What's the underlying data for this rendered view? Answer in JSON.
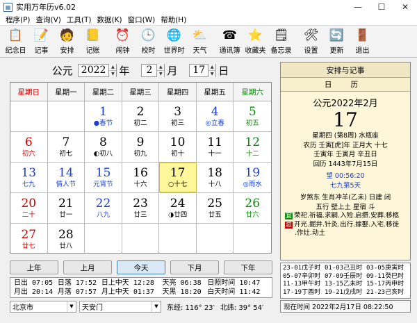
{
  "window": {
    "title": "实用万年历v6.02",
    "controls": [
      "—",
      "☐",
      "✕"
    ]
  },
  "menu": [
    "程序(P)",
    "查询(V)",
    "工具(T)",
    "数据(K)",
    "窗口(W)",
    "帮助(H)"
  ],
  "toolbar": [
    {
      "label": "纪念日",
      "icon": "memorial-icon",
      "glyph": "📋"
    },
    {
      "label": "记事",
      "icon": "note-icon",
      "glyph": "📝"
    },
    {
      "label": "安排",
      "icon": "schedule-icon",
      "glyph": "🧑"
    },
    {
      "label": "记账",
      "icon": "ledger-icon",
      "glyph": "📒"
    },
    {
      "label": "闹钟",
      "icon": "alarm-icon",
      "glyph": "⏰"
    },
    {
      "label": "校时",
      "icon": "time-sync-icon",
      "glyph": "🕒"
    },
    {
      "label": "世界时",
      "icon": "globe-icon",
      "glyph": "🌐"
    },
    {
      "label": "天气",
      "icon": "weather-icon",
      "glyph": "⛅"
    },
    {
      "label": "通讯簿",
      "icon": "address-book-icon",
      "glyph": "☎"
    },
    {
      "label": "收藏夹",
      "icon": "favorites-icon",
      "glyph": "⭐"
    },
    {
      "label": "备忘录",
      "icon": "memo-icon",
      "glyph": "🗒"
    },
    {
      "label": "设置",
      "icon": "settings-icon",
      "glyph": "🛠"
    },
    {
      "label": "更新",
      "icon": "update-icon",
      "glyph": "🔄"
    },
    {
      "label": "退出",
      "icon": "exit-icon",
      "glyph": "🚪"
    }
  ],
  "yearbar": {
    "prefix": "公元",
    "year": "2022",
    "year_unit": "年",
    "month": "2",
    "month_unit": "月",
    "day": "17",
    "day_unit": "日"
  },
  "weekdays": [
    {
      "label": "星期日",
      "color": "#d00000"
    },
    {
      "label": "星期一",
      "color": "#000000"
    },
    {
      "label": "星期二",
      "color": "#000000"
    },
    {
      "label": "星期三",
      "color": "#000000"
    },
    {
      "label": "星期四",
      "color": "#000000"
    },
    {
      "label": "星期五",
      "color": "#000000"
    },
    {
      "label": "星期六",
      "color": "#0a8a0a"
    }
  ],
  "weeks": [
    [
      null,
      null,
      {
        "d": "1",
        "sub": "●春节",
        "c": "#1a3fd0",
        "sc": "#1a3fd0"
      },
      {
        "d": "2",
        "sub": "初二",
        "c": "#000",
        "sc": "#000"
      },
      {
        "d": "3",
        "sub": "初三",
        "c": "#000",
        "sc": "#000"
      },
      {
        "d": "4",
        "sub": "◎立春",
        "c": "#1a3fd0",
        "sc": "#1a3fd0"
      },
      {
        "d": "5",
        "sub": "初五",
        "c": "#0a8a0a",
        "sc": "#0a8a0a"
      }
    ],
    [
      {
        "d": "6",
        "sub": "初六",
        "c": "#d00000",
        "sc": "#d00000"
      },
      {
        "d": "7",
        "sub": "初七",
        "c": "#000",
        "sc": "#000"
      },
      {
        "d": "8",
        "sub": "◐初八",
        "c": "#000",
        "sc": "#000"
      },
      {
        "d": "9",
        "sub": "初九",
        "c": "#000",
        "sc": "#000"
      },
      {
        "d": "10",
        "sub": "初十",
        "c": "#000",
        "sc": "#000"
      },
      {
        "d": "11",
        "sub": "十一",
        "c": "#000",
        "sc": "#000"
      },
      {
        "d": "12",
        "sub": "十二",
        "c": "#0a8a0a",
        "sc": "#0a8a0a"
      }
    ],
    [
      {
        "d": "13",
        "sub": "七九",
        "c": "#1a3fd0",
        "sc": "#1a3fd0"
      },
      {
        "d": "14",
        "sub": "情人节",
        "c": "#1a3fd0",
        "sc": "#1a3fd0"
      },
      {
        "d": "15",
        "sub": "元宵节",
        "c": "#1a3fd0",
        "sc": "#1a3fd0"
      },
      {
        "d": "16",
        "sub": "十六",
        "c": "#000",
        "sc": "#000"
      },
      {
        "d": "17",
        "sub": "○十七",
        "c": "#000",
        "sc": "#000",
        "today": true
      },
      {
        "d": "18",
        "sub": "十八",
        "c": "#000",
        "sc": "#000"
      },
      {
        "d": "19",
        "sub": "◎雨水",
        "c": "#1a3fd0",
        "sc": "#1a3fd0"
      }
    ],
    [
      {
        "d": "20",
        "sub": "二十",
        "c": "#d00000",
        "sc": "#d00000"
      },
      {
        "d": "21",
        "sub": "廿一",
        "c": "#000",
        "sc": "#000"
      },
      {
        "d": "22",
        "sub": "八九",
        "c": "#1a3fd0",
        "sc": "#1a3fd0"
      },
      {
        "d": "23",
        "sub": "廿三",
        "c": "#000",
        "sc": "#000"
      },
      {
        "d": "24",
        "sub": "◑廿四",
        "c": "#000",
        "sc": "#000"
      },
      {
        "d": "25",
        "sub": "廿五",
        "c": "#000",
        "sc": "#000"
      },
      {
        "d": "26",
        "sub": "廿六",
        "c": "#0a8a0a",
        "sc": "#0a8a0a"
      }
    ],
    [
      {
        "d": "27",
        "sub": "廿七",
        "c": "#d00000",
        "sc": "#d00000"
      },
      {
        "d": "28",
        "sub": "廿八",
        "c": "#000",
        "sc": "#000"
      },
      null,
      null,
      null,
      null,
      null
    ]
  ],
  "nav": [
    "上年",
    "上月",
    "今天",
    "下月",
    "下年"
  ],
  "sun": [
    [
      "日出 07:05",
      "日落 17:52",
      "日上中天 12:28",
      "天亮 06:38",
      "日照时间 10:47"
    ],
    [
      "月出 20:14",
      "月落 07:57",
      "月上中天 01:37",
      "天黑 18:20",
      "白天时间 11:42"
    ]
  ],
  "location": {
    "city": "北京市",
    "place": "天安门",
    "lng": "东经: 116° 23′",
    "lat": "北纬: 39° 54′"
  },
  "right": {
    "header": "安排与记事",
    "tab": "日 历",
    "date_title": "公元2022年2月",
    "day": "17",
    "lines": [
      "星期四 (第8周) 水瓶座",
      "农历 壬寅[虎]年 正月大 十七",
      "壬寅年 壬寅月 辛丑日",
      "回历 1443年7月15日"
    ],
    "moon": "望 00:56:20",
    "jiu": "七九第5天",
    "sui": "岁煞东 生肖冲羊(乙未) 日建 闭",
    "xing": "五行 壁上土 星宿 斗",
    "yi_tag": "宜",
    "yi": "荣祀.祈福.求嗣.入殓.启攒.安葬.移柩",
    "ji_tag": "忌",
    "ji": "开光.掘井.针灸.出行.嫁娶.入宅.移徙",
    "ji2": ".作灶.动土"
  },
  "hours": [
    [
      "23-01戊子时",
      "01-03己丑时",
      "03-05庚寅时"
    ],
    [
      "05-07辛卯时",
      "07-09壬辰时",
      "09-11癸巳时"
    ],
    [
      "11-13甲午时",
      "13-15乙未时",
      "15-17丙申时"
    ],
    [
      "17-19丁酉时",
      "19-21戊戌时",
      "21-23己亥时"
    ]
  ],
  "now": "现在时间 2022年2月17日 08:22:50"
}
